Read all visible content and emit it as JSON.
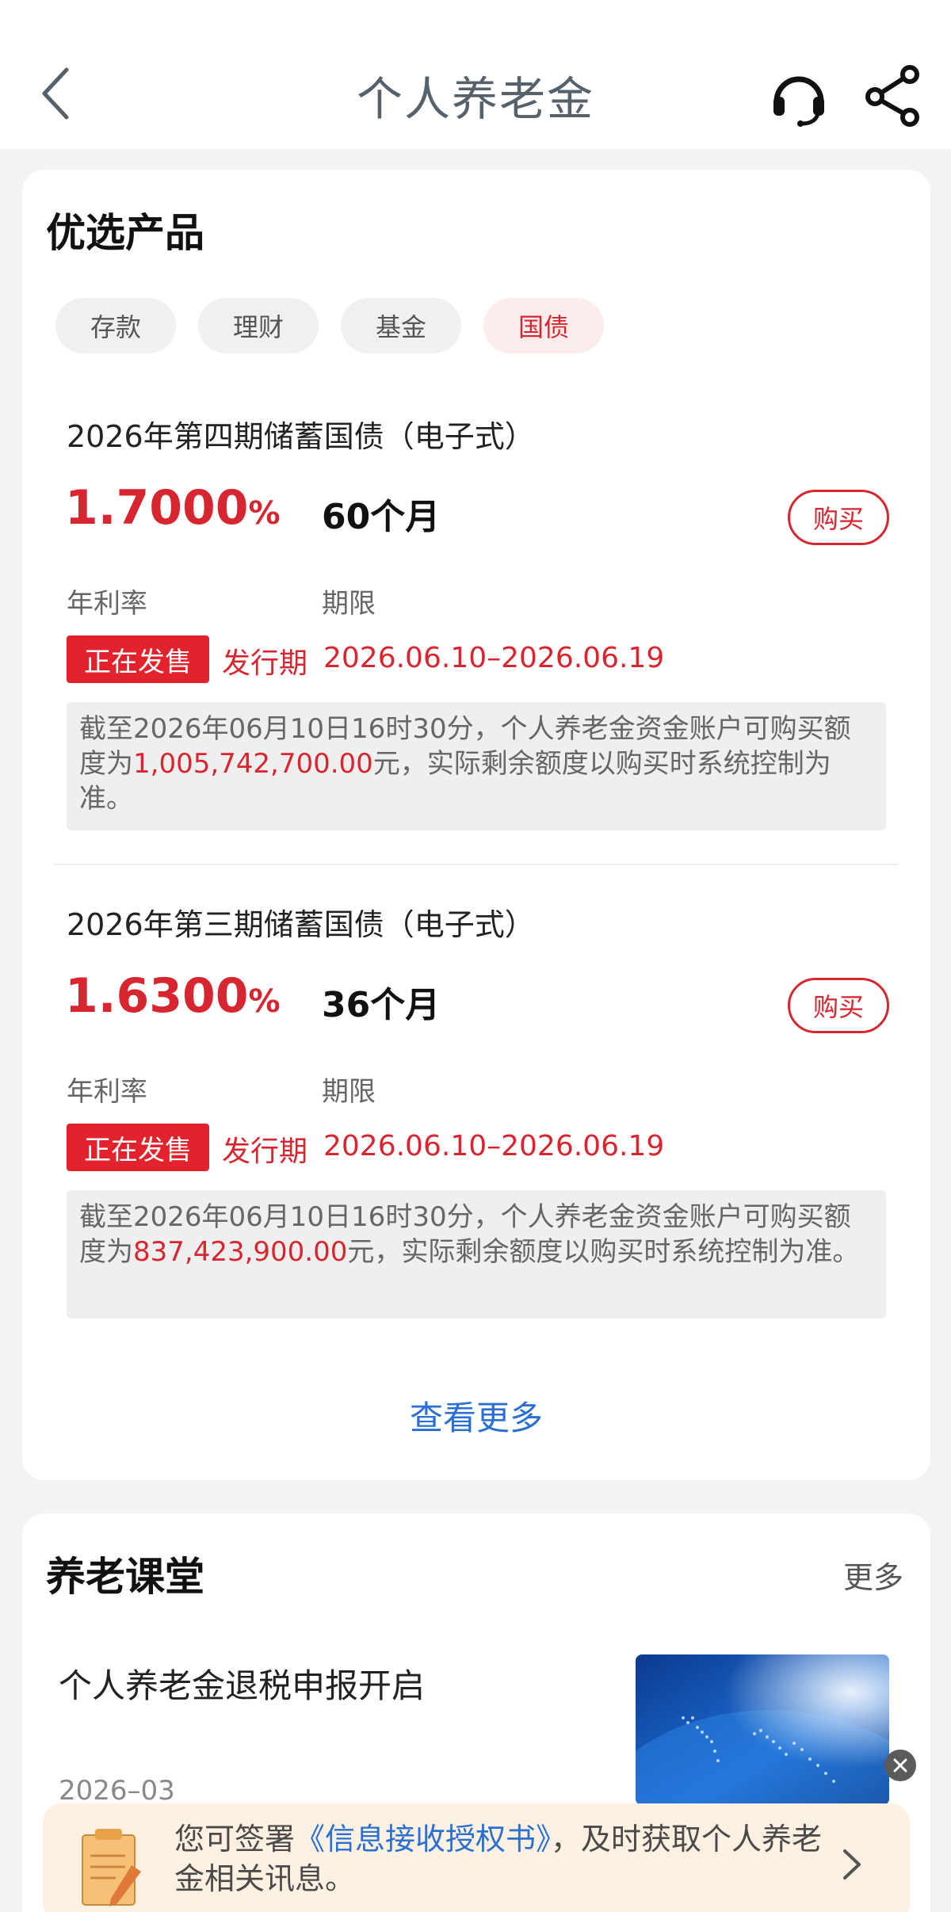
{
  "header": {
    "title": "个人养老金"
  },
  "products_section": {
    "title": "优选产品",
    "tabs": [
      {
        "label": "存款",
        "active": false
      },
      {
        "label": "理财",
        "active": false
      },
      {
        "label": "基金",
        "active": false
      },
      {
        "label": "国债",
        "active": true
      }
    ],
    "items": [
      {
        "name": "2026年第四期储蓄国债（电子式）",
        "rate": "1.7000",
        "rate_unit": "%",
        "term": "60个月",
        "buy_label": "购买",
        "rate_label": "年利率",
        "term_label": "期限",
        "badge": "正在发售",
        "period_label": "发行期",
        "period": "2026.06.10–2026.06.19",
        "notice_prefix": "截至2026年06月10日16时30分，个人养老金资金账户可购买额度为",
        "notice_amount": "1,005,742,700.00",
        "notice_suffix": "元，实际剩余额度以购买时系统控制为准。"
      },
      {
        "name": "2026年第三期储蓄国债（电子式）",
        "rate": "1.6300",
        "rate_unit": "%",
        "term": "36个月",
        "buy_label": "购买",
        "rate_label": "年利率",
        "term_label": "期限",
        "badge": "正在发售",
        "period_label": "发行期",
        "period": "2026.06.10–2026.06.19",
        "notice_prefix": "截至2026年06月10日16时30分，个人养老金资金账户可购买额度为",
        "notice_amount": "837,423,900.00",
        "notice_suffix": "元，实际剩余额度以购买时系统控制为准。"
      }
    ],
    "more_label": "查看更多"
  },
  "classroom": {
    "title": "养老课堂",
    "more_label": "更多",
    "article": {
      "title": "个人养老金退税申报开启",
      "date": "2026–03"
    }
  },
  "banner": {
    "text_prefix": "您可签署",
    "link": "《信息接收授权书》",
    "text_suffix": "，及时获取个人养老金相关讯息。"
  },
  "colors": {
    "accent_red": "#d7262f",
    "link_blue": "#2a6fd1"
  },
  "icons": [
    "back-icon",
    "headset-icon",
    "share-icon",
    "document-icon",
    "chevron-right-icon",
    "close-icon"
  ]
}
